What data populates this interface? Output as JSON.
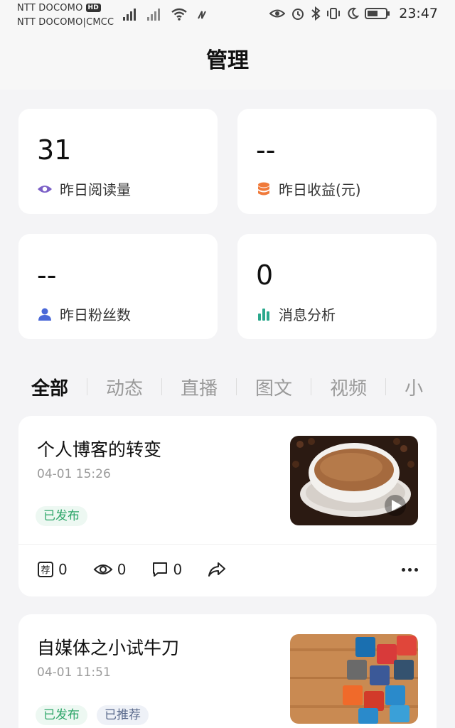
{
  "status_bar": {
    "carrier_1": "NTT DOCOMO",
    "hd_badge": "HD",
    "carrier_2": "NTT DOCOMO|CMCC",
    "time": "23:47"
  },
  "header": {
    "title": "管理"
  },
  "stats": [
    {
      "value": "31",
      "label": "昨日阅读量",
      "icon": "eye-icon",
      "color": "#7b5fc7"
    },
    {
      "value": "--",
      "label": "昨日收益(元)",
      "icon": "coin-stack-icon",
      "color": "#f07a3a"
    },
    {
      "value": "--",
      "label": "昨日粉丝数",
      "icon": "user-icon",
      "color": "#4a68d8"
    },
    {
      "value": "0",
      "label": "消息分析",
      "icon": "bar-chart-icon",
      "color": "#2aa88c"
    }
  ],
  "tabs": [
    "全部",
    "动态",
    "直播",
    "图文",
    "视频",
    "小"
  ],
  "articles": [
    {
      "title": "个人博客的转变",
      "time": "04-01 15:26",
      "tags": [
        "已发布"
      ],
      "thumbnail": "coffee-cup-image",
      "recommend_count": "0",
      "view_count": "0",
      "comment_count": "0"
    },
    {
      "title": "自媒体之小试牛刀",
      "time": "04-01 11:51",
      "tags": [
        "已发布",
        "已推荐"
      ],
      "thumbnail": "social-media-cubes-image"
    }
  ],
  "colors": {
    "published": "#2fa66a",
    "background": "#f4f4f6",
    "card": "#ffffff"
  }
}
